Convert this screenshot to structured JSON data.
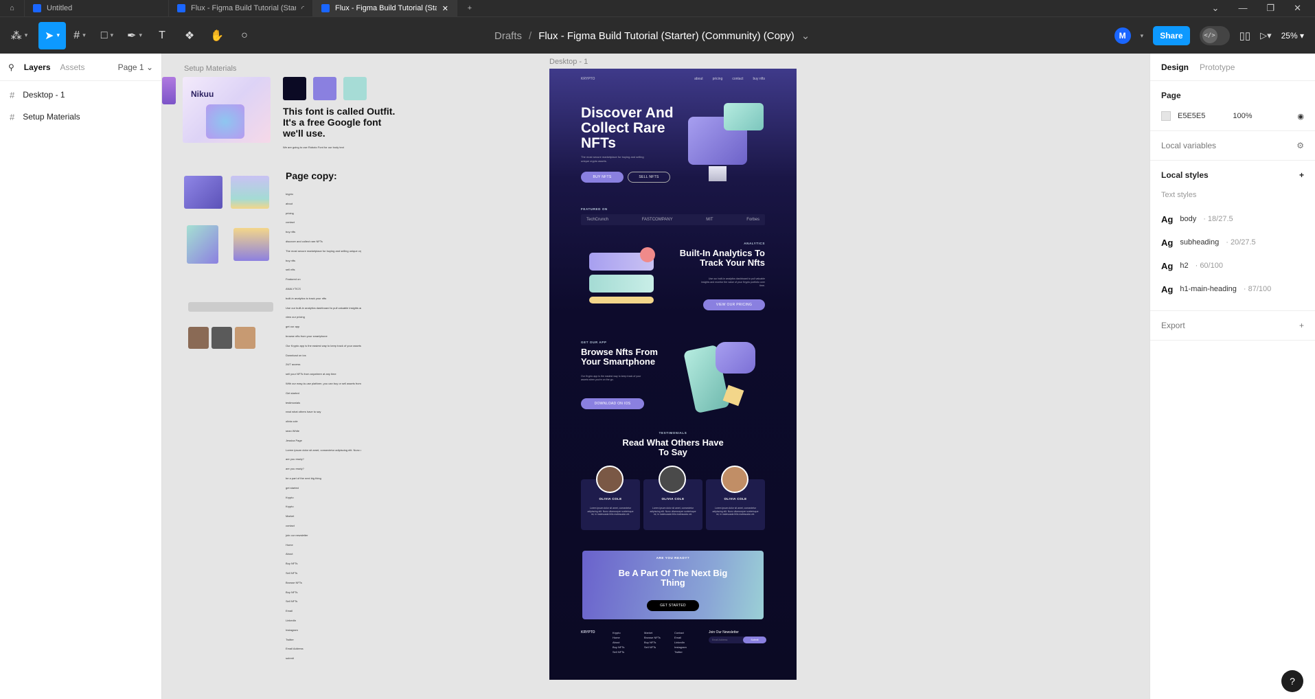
{
  "tabs": {
    "home_icon": "home-icon",
    "items": [
      {
        "label": "Untitled"
      },
      {
        "label": "Flux - Figma Build Tutorial (Starter"
      },
      {
        "label": "Flux - Figma Build Tutorial (Starter"
      }
    ],
    "new_tab": "+"
  },
  "toolbar": {
    "breadcrumb_root": "Drafts",
    "breadcrumb_sep": "/",
    "file_name": "Flux - Figma Build Tutorial (Starter) (Community) (Copy)",
    "avatar_initial": "M",
    "share_label": "Share",
    "zoom": "25%"
  },
  "left_panel": {
    "tab_layers": "Layers",
    "tab_assets": "Assets",
    "page_selector": "Page 1",
    "layers": [
      {
        "label": "Desktop - 1"
      },
      {
        "label": "Setup Materials"
      }
    ]
  },
  "right_panel": {
    "tab_design": "Design",
    "tab_prototype": "Prototype",
    "page_title": "Page",
    "page_color": "E5E5E5",
    "page_opacity": "100%",
    "local_variables": "Local variables",
    "local_styles": "Local styles",
    "text_styles_heading": "Text styles",
    "text_styles": [
      {
        "ag": "Ag",
        "name": "body",
        "meta": "· 18/27.5"
      },
      {
        "ag": "Ag",
        "name": "subheading",
        "meta": "· 20/27.5"
      },
      {
        "ag": "Ag",
        "name": "h2",
        "meta": "· 60/100"
      },
      {
        "ag": "Ag",
        "name": "h1-main-heading",
        "meta": "· 87/100"
      }
    ],
    "export": "Export"
  },
  "canvas": {
    "setup_label": "Setup Materials",
    "desktop_label": "Desktop - 1",
    "swatches": [
      "#0b0a24",
      "#8a80e0",
      "#a6dcd6"
    ],
    "nikuu": "Nikuu",
    "font_note": "This font is called Outfit. It's a free Google font we'll use.",
    "font_sub": "We are going to use Roboto Font for our body text",
    "page_copy": "Page copy:",
    "copy_lines": [
      "krypto",
      "about",
      "pricing",
      "contact",
      "buy nfts",
      "discover and collect rare NFTs",
      "The most secure marketplace for buying and selling unique crypto assets.",
      "buy nfts",
      "sell nfts",
      "Featured on",
      "ANALYTICS",
      "built-in analytics to track your nfts",
      "Use our built-in analytics dashboard to pull valuable insights and monitor the value of your Krypto portfolio over time.",
      "view our pricing",
      "get our app",
      "browse nfts from your smartphone",
      "Our Krypto app is the easiest way to keep track of your assets when you're on the go.",
      "Download on ios",
      "24/7 access",
      "sell your NFTs from anywhere at any time",
      "With our easy-to-use platform, you can buy or sell assets from anywhere in the world, at any time.",
      "Get started",
      "testimonials",
      "read what others have to say",
      "olivia cole",
      "sean White",
      "Jessica Page",
      "Lorem ipsum dolor sit amet, consectetur adipiscing elit. Nunc ullamcorper scelerisque mi, in malesuada felis malesuada vel.",
      "are you ready?",
      "are you ready?",
      "be a part of the next big thing",
      "get started",
      "Krypto",
      "Krypto",
      "Market",
      "contact",
      "join our newsletter",
      "Home",
      "About",
      "Buy NFTs",
      "Sell NFTs",
      "Browse NFTs",
      "Buy NFTs",
      "Sell NFTs",
      "Email",
      "LinkedIn",
      "Instagram",
      "Twitter",
      "Email Address",
      "submit"
    ]
  },
  "desktop": {
    "brand": "KRYPTO",
    "nav": [
      "about",
      "pricing",
      "contact",
      "buy nfts"
    ],
    "hero_title": "Discover And Collect Rare NFTs",
    "hero_text": "The most secure marketplace for buying and selling unique crypto assets.",
    "buy": "BUY NFTS",
    "sell": "SELL NFTS",
    "featured": "FEATURED ON",
    "logos": [
      "TechCrunch",
      "FASTCOMPANY",
      "MIT",
      "Forbes"
    ],
    "analytics_kicker": "ANALYTICS",
    "analytics_title": "Built-In Analytics To Track Your Nfts",
    "analytics_text": "Use our built-in analytics dashboard to pull valuable insights and monitor the value of your Krypto portfolio over time.",
    "pricing_btn": "VIEW OUR PRICING",
    "app_kicker": "GET OUR APP",
    "app_title": "Browse Nfts From Your Smartphone",
    "app_text": "Our Krypto app is the easiest way to keep track of your assets when you're on the go.",
    "ios_btn": "DOWNLOAD ON IOS",
    "testi_kicker": "TESTIMONIALS",
    "testi_title": "Read What Others Have To Say",
    "testimonials": [
      {
        "name": "OLIVIA COLE",
        "text": "Lorem ipsum dolor sit amet, consectetur adipiscing elit. Nunc ullamcorper scelerisque mi, in malesuada felis malesuada vel."
      },
      {
        "name": "OLIVIA COLE",
        "text": "Lorem ipsum dolor sit amet, consectetur adipiscing elit. Nunc ullamcorper scelerisque mi, in malesuada felis malesuada vel."
      },
      {
        "name": "OLIVIA COLE",
        "text": "Lorem ipsum dolor sit amet, consectetur adipiscing elit. Nunc ullamcorper scelerisque mi, in malesuada felis malesuada vel."
      }
    ],
    "cta_kicker": "ARE YOU READY?",
    "cta_title": "Be A Part Of The Next Big Thing",
    "cta_btn": "GET STARTED",
    "footer_brand": "KRYPTO",
    "footer_cols": [
      {
        "title": "Krypto",
        "items": [
          "Home",
          "About",
          "Buy NFTs",
          "Sell NFTs"
        ]
      },
      {
        "title": "Market",
        "items": [
          "Browse NFTs",
          "Buy NFTs",
          "Sell NFTs"
        ]
      },
      {
        "title": "Contact",
        "items": [
          "Email",
          "LinkedIn",
          "Instagram",
          "Twitter"
        ]
      }
    ],
    "newsletter": "Join Our Newsletter",
    "email_placeholder": "Email Address",
    "submit": "Submit"
  },
  "help": "?"
}
